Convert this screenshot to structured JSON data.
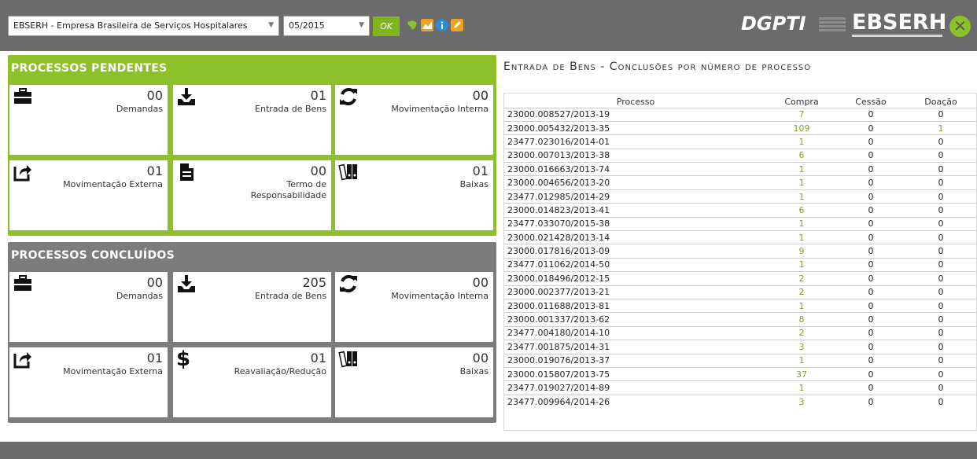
{
  "header": {
    "org_select": "EBSERH - Empresa Brasileira de Serviços Hospitalares",
    "month_select": "05/2015",
    "ok_label": "OK",
    "brand_dgpti": "DGPTI",
    "brand_ebserh": "EBSERH"
  },
  "pendentes": {
    "title": "PROCESSOS PENDENTES",
    "cards": [
      {
        "value": "00",
        "label": "Demandas",
        "icon": "briefcase-icon"
      },
      {
        "value": "01",
        "label": "Entrada de Bens",
        "icon": "inbox-download-icon"
      },
      {
        "value": "00",
        "label": "Movimentação Interna",
        "icon": "refresh-icon"
      },
      {
        "value": "01",
        "label": "Movimentação Externa",
        "icon": "share-icon"
      },
      {
        "value": "00",
        "label": "Termo de Responsabilidade",
        "icon": "document-icon"
      },
      {
        "value": "01",
        "label": "Baixas",
        "icon": "archive-binders-icon"
      }
    ]
  },
  "concluidos": {
    "title": "PROCESSOS CONCLUÍDOS",
    "cards": [
      {
        "value": "00",
        "label": "Demandas",
        "icon": "briefcase-icon"
      },
      {
        "value": "205",
        "label": "Entrada de Bens",
        "icon": "inbox-download-icon"
      },
      {
        "value": "00",
        "label": "Movimentação Interna",
        "icon": "refresh-icon"
      },
      {
        "value": "01",
        "label": "Movimentação Externa",
        "icon": "share-icon"
      },
      {
        "value": "01",
        "label": "Reavaliação/Redução",
        "icon": "dollar-icon"
      },
      {
        "value": "00",
        "label": "Baixas",
        "icon": "archive-binders-icon"
      }
    ]
  },
  "table": {
    "title": "Entrada de Bens - Conclusões por número de processo",
    "columns": [
      "Processo",
      "Compra",
      "Cessão",
      "Doação"
    ],
    "rows": [
      [
        "23000.008527/2013-19",
        "7",
        "0",
        "0"
      ],
      [
        "23000.005432/2013-35",
        "109",
        "0",
        "1"
      ],
      [
        "23477.023016/2014-01",
        "1",
        "0",
        "0"
      ],
      [
        "23000.007013/2013-38",
        "6",
        "0",
        "0"
      ],
      [
        "23000.016663/2013-74",
        "1",
        "0",
        "0"
      ],
      [
        "23000.004656/2013-20",
        "1",
        "0",
        "0"
      ],
      [
        "23477.012985/2014-29",
        "1",
        "0",
        "0"
      ],
      [
        "23000.014823/2013-41",
        "6",
        "0",
        "0"
      ],
      [
        "23477.033070/2015-38",
        "1",
        "0",
        "0"
      ],
      [
        "23000.021428/2013-14",
        "1",
        "0",
        "0"
      ],
      [
        "23000.017816/2013-09",
        "9",
        "0",
        "0"
      ],
      [
        "23477.011062/2014-50",
        "1",
        "0",
        "0"
      ],
      [
        "23000.018496/2012-15",
        "2",
        "0",
        "0"
      ],
      [
        "23000.002377/2013-21",
        "2",
        "0",
        "0"
      ],
      [
        "23000.011688/2013-81",
        "1",
        "0",
        "0"
      ],
      [
        "23000.001337/2013-62",
        "8",
        "0",
        "0"
      ],
      [
        "23477.004180/2014-10",
        "2",
        "0",
        "0"
      ],
      [
        "23477.001875/2014-31",
        "3",
        "0",
        "0"
      ],
      [
        "23000.019076/2013-37",
        "1",
        "0",
        "0"
      ],
      [
        "23000.015807/2013-75",
        "37",
        "0",
        "0"
      ],
      [
        "23477.019027/2014-89",
        "1",
        "0",
        "0"
      ],
      [
        "23477.009964/2014-26",
        "3",
        "0",
        "0"
      ]
    ]
  }
}
